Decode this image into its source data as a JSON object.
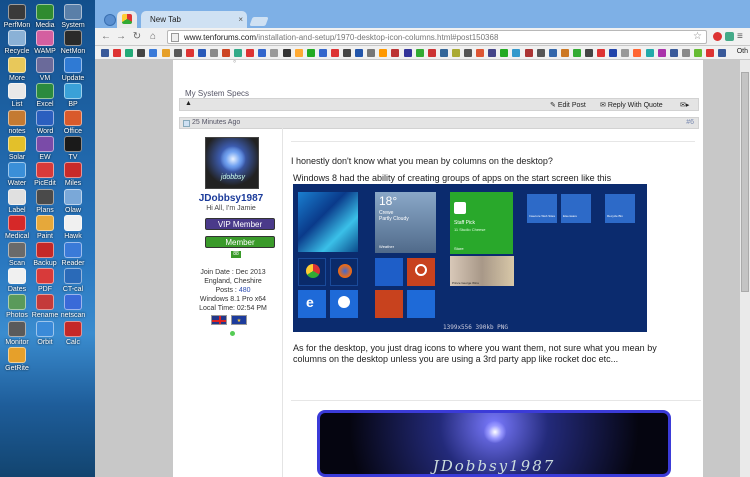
{
  "desktop": {
    "icons": [
      {
        "label": "PerfMon",
        "color": "#3a3a3a"
      },
      {
        "label": "Media",
        "color": "#2f8b2f"
      },
      {
        "label": "System",
        "color": "#5a7fa8"
      },
      {
        "label": "Recycle",
        "color": "#8ab1d6"
      },
      {
        "label": "WAMP",
        "color": "#d45fa0"
      },
      {
        "label": "NetMon",
        "color": "#2a2a2a"
      },
      {
        "label": "More",
        "color": "#e8c85a"
      },
      {
        "label": "VM",
        "color": "#6a6a9a"
      },
      {
        "label": "Update",
        "color": "#2f7ad4"
      },
      {
        "label": "List",
        "color": "#e8e8e8"
      },
      {
        "label": "Excel",
        "color": "#2b8a3e"
      },
      {
        "label": "BP",
        "color": "#3aa1d8"
      },
      {
        "label": "notes",
        "color": "#c47a32"
      },
      {
        "label": "Word",
        "color": "#2b5fbf"
      },
      {
        "label": "Office",
        "color": "#d95a2b"
      },
      {
        "label": "Solar",
        "color": "#e3c02a"
      },
      {
        "label": "EW",
        "color": "#7a4ba8"
      },
      {
        "label": "TV",
        "color": "#1a1a1a"
      },
      {
        "label": "Water",
        "color": "#3a8fd8"
      },
      {
        "label": "PicEdit",
        "color": "#d83a3a"
      },
      {
        "label": "Miles",
        "color": "#c92a2a"
      },
      {
        "label": "Label",
        "color": "#e0e0e0"
      },
      {
        "label": "Plans",
        "color": "#4a4a4a"
      },
      {
        "label": "Olaw",
        "color": "#7aa8d8"
      },
      {
        "label": "Medical",
        "color": "#d62828"
      },
      {
        "label": "Paint",
        "color": "#e6a83a"
      },
      {
        "label": "Hawk",
        "color": "#f0f0f0"
      },
      {
        "label": "Scan",
        "color": "#6a6a6a"
      },
      {
        "label": "Backup",
        "color": "#c42828"
      },
      {
        "label": "Reader",
        "color": "#3a7ad8"
      },
      {
        "label": "Dates",
        "color": "#f0f0f0"
      },
      {
        "label": "PDF",
        "color": "#d83a3a"
      },
      {
        "label": "CT-cal",
        "color": "#2a6ab8"
      },
      {
        "label": "Photos",
        "color": "#5a9a5a"
      },
      {
        "label": "Rename",
        "color": "#c43a3a"
      },
      {
        "label": "netscan",
        "color": "#3a6ad8"
      },
      {
        "label": "Monitor",
        "color": "#5a5a5a"
      },
      {
        "label": "Orbit",
        "color": "#3a8ad8"
      },
      {
        "label": "Calc",
        "color": "#c42828"
      },
      {
        "label": "GetRite",
        "color": "#e6a02a"
      }
    ]
  },
  "browser": {
    "tabs": [
      {
        "label": ""
      },
      {
        "label": "New Tab"
      }
    ],
    "url_host": "www.tenforums.com",
    "url_path": "/installation-and-setup/1970-desktop-icon-columns.html#post150368",
    "bookmarks_end": "Oth"
  },
  "thread": {
    "system_specs": "My System Specs",
    "post_time": "25 Minutes Ago",
    "post_number": "#6",
    "edit_post": "Edit Post",
    "reply_quote": "Reply With Quote"
  },
  "user": {
    "name": "JDobbsy1987",
    "tagline": "Hi All, I'm Jamie",
    "badge_vip": "VIP Member",
    "badge_member": "Member",
    "rep": "88",
    "join_date": "Join Date : Dec 2013",
    "location": "England, Cheshire",
    "posts_label": "Posts : ",
    "posts": "480",
    "os": "Windows 8.1 Pro x64",
    "local_time": "Local Time: 02:54 PM"
  },
  "post": {
    "line1": "I honestly don't know what you mean by columns on the desktop?",
    "line2": "Windows 8 had the ability of creating groups of apps on the start screen like this",
    "line3": "As for the desktop, you just drag icons to where you want them, not sure what you mean by columns on the desktop unless you are using a 3rd party app like rocket doc etc...",
    "image_caption": "1399x556 390kb PNG",
    "sig_text": "JDobbsy1987"
  },
  "win8_tiles": {
    "weather_temp": "18°",
    "weather_loc": "Crewe",
    "weather_cond": "Partly Cloudy",
    "weather_w": "Weather",
    "store_title": "Staff Pick",
    "store_sub": "11 Studio Cheese",
    "store_label": "Store",
    "chrome": "Google Chrome",
    "firefox": "Mozilla Firefox",
    "ie": "Internet Explorer",
    "teamviewer": "TeamViewer 9",
    "ccleaner": "CCleaner",
    "nvidia": "NVIDIA GeForce Experience",
    "recycle": "Recycle Bin",
    "insecure": "Insecure Web Sites",
    "eisenware": "Eisenware",
    "people_text": "Prince George Wins"
  }
}
